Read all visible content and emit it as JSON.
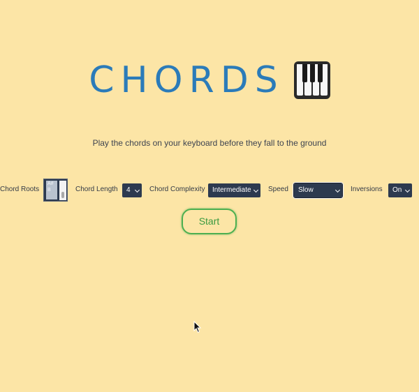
{
  "header": {
    "title": "CHORDS"
  },
  "subtitle": "Play the chords on your keyboard before they fall to the ground",
  "controls": {
    "chord_roots": {
      "label": "Chord Roots",
      "visible_items": [
        "A#",
        "B"
      ]
    },
    "chord_length": {
      "label": "Chord Length",
      "value": "4"
    },
    "chord_complexity": {
      "label": "Chord Complexity",
      "value": "Intermediate"
    },
    "speed": {
      "label": "Speed",
      "value": "Slow"
    },
    "inversions": {
      "label": "Inversions",
      "value": "On"
    }
  },
  "start_button": {
    "label": "Start"
  },
  "colors": {
    "background": "#fce5a6",
    "title": "#2b7bb9",
    "select_bg": "#2d3a4f",
    "start_green": "#4caf50"
  },
  "icons": {
    "title_emoji": "musical-keyboard-icon",
    "cursor": "mouse-pointer-icon"
  }
}
